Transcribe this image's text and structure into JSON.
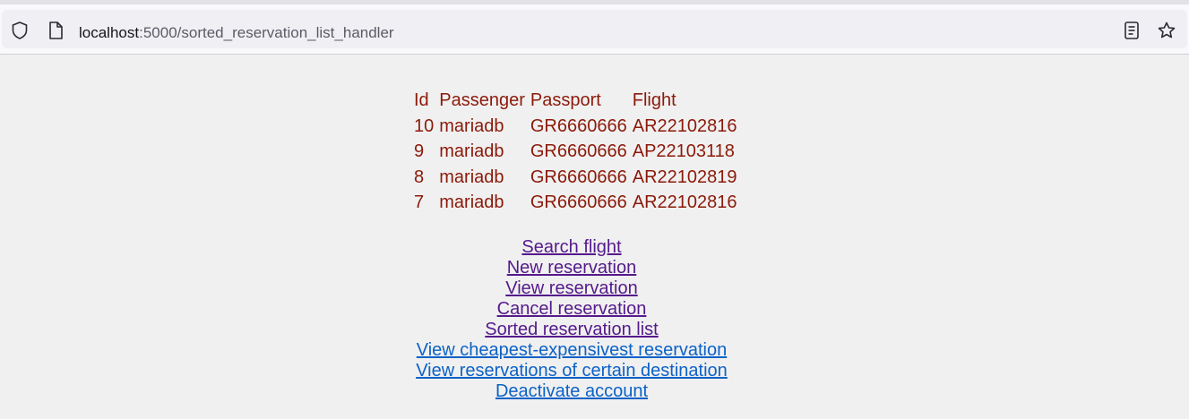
{
  "browser": {
    "url_host": "localhost",
    "url_path": ":5000/sorted_reservation_list_handler"
  },
  "table": {
    "headers": [
      "Id",
      "Passenger",
      "Passport",
      "Flight"
    ],
    "rows": [
      [
        "10",
        "mariadb",
        "GR6660666",
        "AR22102816"
      ],
      [
        "9",
        "mariadb",
        "GR6660666",
        "AP22103118"
      ],
      [
        "8",
        "mariadb",
        "GR6660666",
        "AR22102819"
      ],
      [
        "7",
        "mariadb",
        "GR6660666",
        "AR22102816"
      ]
    ]
  },
  "links": [
    {
      "label": "Search flight",
      "visited": true
    },
    {
      "label": "New reservation",
      "visited": true
    },
    {
      "label": "View reservation",
      "visited": true
    },
    {
      "label": "Cancel reservation",
      "visited": true
    },
    {
      "label": "Sorted reservation list",
      "visited": true
    },
    {
      "label": "View cheapest-expensivest reservation",
      "visited": false
    },
    {
      "label": "View reservations of certain destination",
      "visited": false
    },
    {
      "label": "Deactivate account",
      "visited": false
    }
  ],
  "colors": {
    "table_text": "#8b1a0a",
    "visited_link": "#551a8b",
    "unvisited_link": "#0c62c7"
  }
}
